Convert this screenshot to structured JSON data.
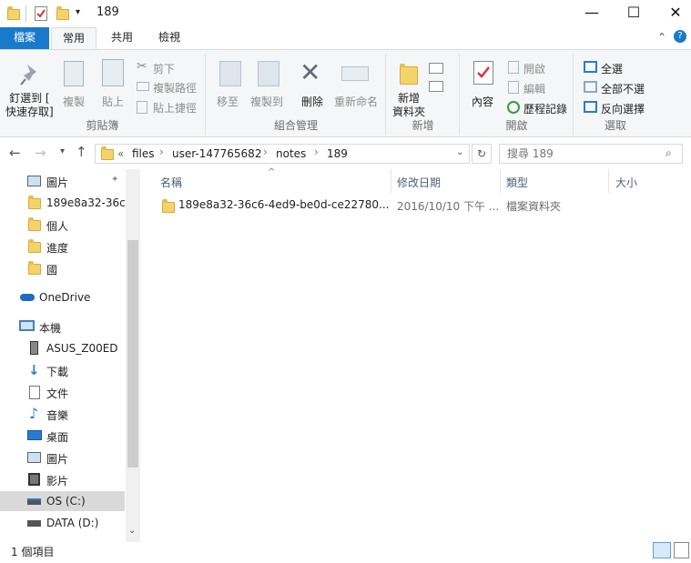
{
  "window": {
    "title": "189"
  },
  "tabs": {
    "file": "檔案",
    "home": "常用",
    "share": "共用",
    "view": "檢視"
  },
  "ribbon": {
    "pin": "釘選到 [\n快速存取]",
    "copy": "複製",
    "paste": "貼上",
    "cut": "剪下",
    "copy_path": "複製路徑",
    "paste_shortcut": "貼上捷徑",
    "clipboard": "剪貼簿",
    "move_to": "移至",
    "copy_to": "複製到",
    "delete": "刪除",
    "rename": "重新命名",
    "organize": "組合管理",
    "new_folder": "新增\n資料夾",
    "new_group": "新增",
    "properties": "內容",
    "open": "開啟",
    "edit": "編輯",
    "history": "歷程記錄",
    "open_group": "開啟",
    "select_all": "全選",
    "select_none": "全部不選",
    "invert": "反向選擇",
    "select_group": "選取"
  },
  "nav": {
    "breadcrumb": [
      "«",
      "files",
      "user-147765682",
      "notes",
      "189"
    ],
    "search_placeholder": "搜尋 189"
  },
  "tree": [
    {
      "label": "圖片",
      "icon": "pictures-icon"
    },
    {
      "label": "189e8a32-36c6",
      "icon": "folder-icon"
    },
    {
      "label": "個人",
      "icon": "folder-icon"
    },
    {
      "label": "進度",
      "icon": "folder-icon"
    },
    {
      "label": "國",
      "icon": "folder-icon"
    },
    {
      "label": "OneDrive",
      "icon": "onedrive-icon"
    },
    {
      "label": "本機",
      "icon": "computer-icon"
    },
    {
      "label": "ASUS_Z00ED",
      "icon": "phone-icon"
    },
    {
      "label": "下載",
      "icon": "download-icon"
    },
    {
      "label": "文件",
      "icon": "documents-icon"
    },
    {
      "label": "音樂",
      "icon": "music-icon"
    },
    {
      "label": "桌面",
      "icon": "desktop-icon"
    },
    {
      "label": "圖片",
      "icon": "pictures-icon"
    },
    {
      "label": "影片",
      "icon": "video-icon"
    },
    {
      "label": "OS (C:)",
      "icon": "drive-icon"
    },
    {
      "label": "DATA (D:)",
      "icon": "drive-icon"
    }
  ],
  "columns": {
    "name": "名稱",
    "modified": "修改日期",
    "type": "類型",
    "size": "大小"
  },
  "files": [
    {
      "name": "189e8a32-36c6-4ed9-be0d-ce22780...",
      "modified": "2016/10/10 下午 ...",
      "type": "檔案資料夾",
      "size": ""
    }
  ],
  "status": {
    "count": "1 個項目"
  },
  "colors": {
    "accent": "#1979ca",
    "folder": "#f5d36b",
    "selected": "#d9d9d9"
  }
}
